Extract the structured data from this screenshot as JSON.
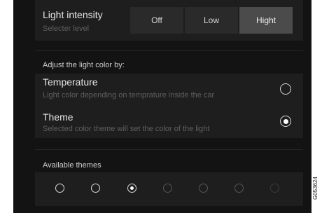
{
  "light_intensity": {
    "title": "Light intensity",
    "subtitle": "Selecter level",
    "options": [
      "Off",
      "Low",
      "Hight"
    ],
    "selected": "Hight"
  },
  "color_section": {
    "heading": "Adjust the light color by:",
    "options": [
      {
        "title": "Temperature",
        "subtitle": "Light color depending on temprature inside the car",
        "selected": false
      },
      {
        "title": "Theme",
        "subtitle": "Selected color theme will set the color of the light",
        "selected": true
      }
    ]
  },
  "themes": {
    "heading": "Available themes",
    "items": [
      {
        "selected": false,
        "enabled": true
      },
      {
        "selected": false,
        "enabled": true
      },
      {
        "selected": true,
        "enabled": true
      },
      {
        "selected": false,
        "enabled": false
      },
      {
        "selected": false,
        "enabled": false
      },
      {
        "selected": false,
        "enabled": false
      },
      {
        "selected": false,
        "enabled": false
      }
    ]
  },
  "figure_code": "G053624",
  "colors": {
    "background": "#131313",
    "panel": "#1e1e1e",
    "segment": "#2a2a2a",
    "segment_selected": "#4b4b4b",
    "text": "#e6e6e6",
    "subtext": "#5f5f5f"
  }
}
